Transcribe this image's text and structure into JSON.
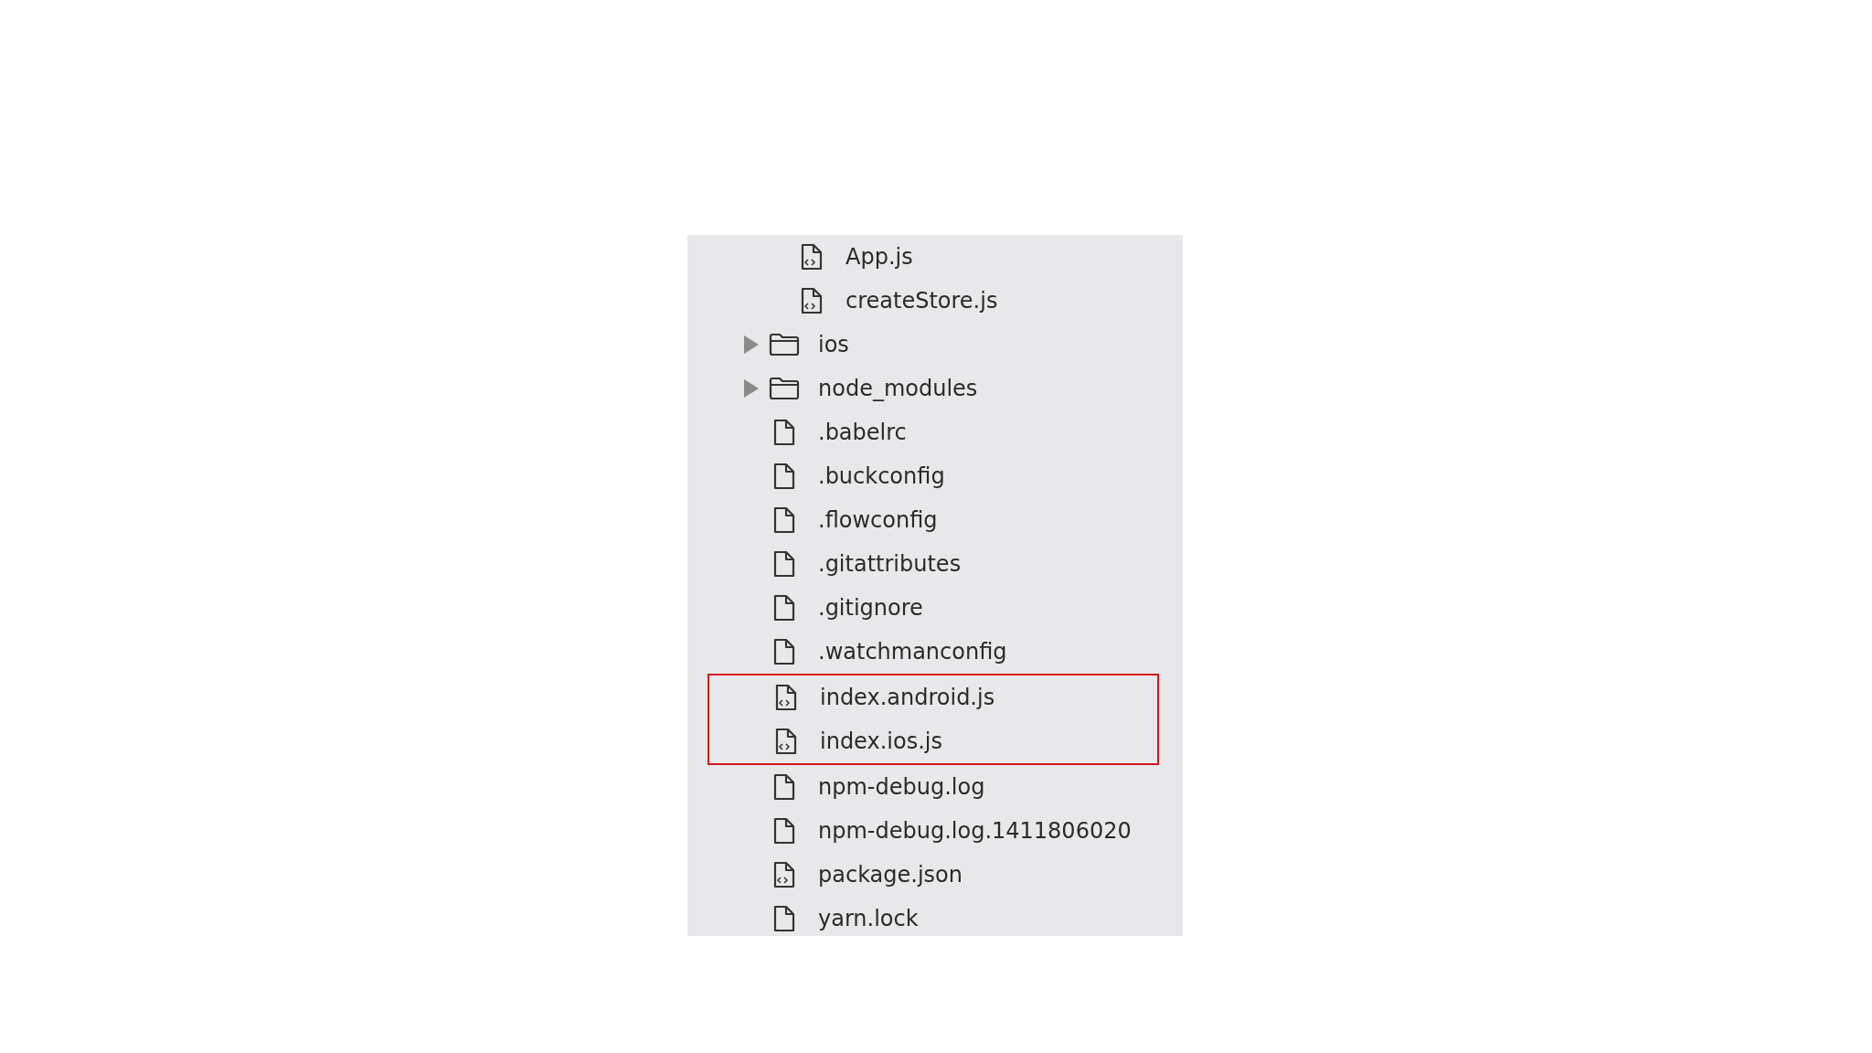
{
  "file_tree": {
    "items": [
      {
        "kind": "hidden_parent",
        "children": [
          {
            "kind": "code_file",
            "name": "App.js",
            "highlighted": false
          },
          {
            "kind": "code_file",
            "name": "createStore.js",
            "highlighted": false
          }
        ]
      },
      {
        "kind": "folder",
        "name": "ios",
        "expanded": false,
        "highlighted": false
      },
      {
        "kind": "folder",
        "name": "node_modules",
        "expanded": false,
        "highlighted": false
      },
      {
        "kind": "file",
        "name": ".babelrc",
        "highlighted": false
      },
      {
        "kind": "file",
        "name": ".buckconfig",
        "highlighted": false
      },
      {
        "kind": "file",
        "name": ".flowconfig",
        "highlighted": false
      },
      {
        "kind": "file",
        "name": ".gitattributes",
        "highlighted": false
      },
      {
        "kind": "file",
        "name": ".gitignore",
        "highlighted": false
      },
      {
        "kind": "file",
        "name": ".watchmanconfig",
        "highlighted": false
      },
      {
        "kind": "code_file",
        "name": "index.android.js",
        "highlighted": true
      },
      {
        "kind": "code_file",
        "name": "index.ios.js",
        "highlighted": true
      },
      {
        "kind": "file",
        "name": "npm-debug.log",
        "highlighted": false
      },
      {
        "kind": "file",
        "name": "npm-debug.log.1411806020",
        "highlighted": false
      },
      {
        "kind": "code_file",
        "name": "package.json",
        "highlighted": false
      },
      {
        "kind": "file",
        "name": "yarn.lock",
        "highlighted": false
      }
    ]
  }
}
